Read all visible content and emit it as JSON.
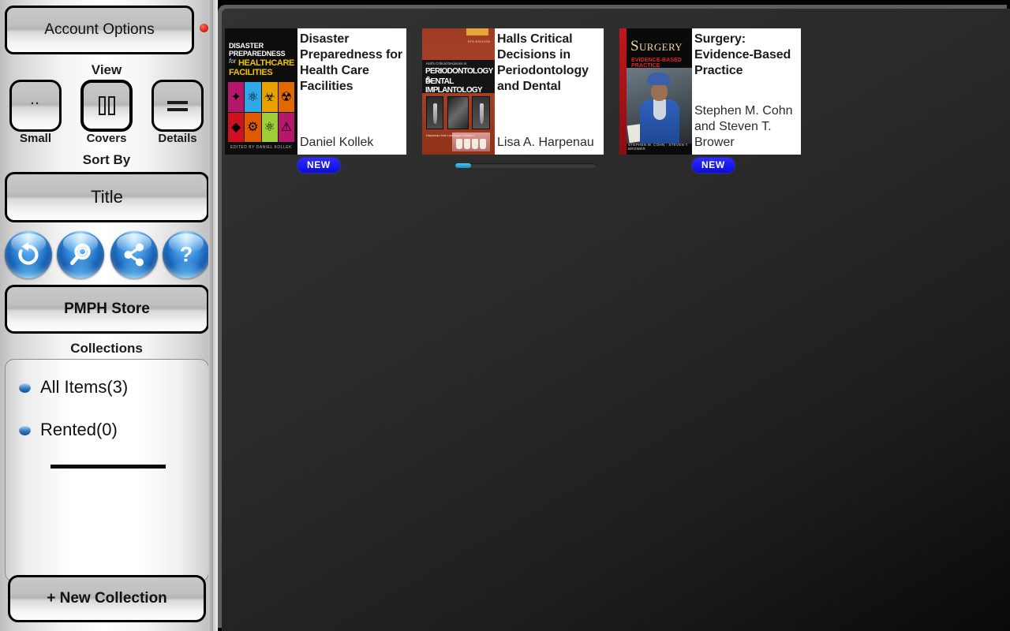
{
  "sidebar": {
    "account_options_label": "Account Options",
    "view_section_label": "View",
    "view_options": [
      {
        "caption": "Small",
        "icon": "small-grid-icon",
        "selected": false
      },
      {
        "caption": "Covers",
        "icon": "covers-icon",
        "selected": true
      },
      {
        "caption": "Details",
        "icon": "details-list-icon",
        "selected": false
      }
    ],
    "sort_by_label": "Sort By",
    "sort_by_value": "Title",
    "action_icons": [
      {
        "name": "refresh-icon",
        "label": "Refresh"
      },
      {
        "name": "search-icon",
        "label": "Search"
      },
      {
        "name": "share-icon",
        "label": "Share"
      },
      {
        "name": "help-icon",
        "label": "Help"
      }
    ],
    "store_button_label": "PMPH Store",
    "collections_label": "Collections",
    "collections": [
      {
        "label": "All Items(3)"
      },
      {
        "label": "Rented(0)"
      }
    ],
    "new_collection_label": "+ New Collection"
  },
  "books": [
    {
      "title": "Disaster Preparedness for Health Care Facilities",
      "author": "Daniel Kollek",
      "badge": "NEW",
      "progress": null,
      "cover": {
        "line1": "DISASTER",
        "line2": "PREPAREDNESS",
        "for": "for",
        "line3": "HEALTHCARE",
        "line4": "FACILITIES",
        "credit": "EDITED BY DANIEL KOLLEK",
        "tiles": [
          "☣",
          "⚗",
          "☢",
          "☣",
          "◆",
          "⚗",
          "⚛",
          "⚠"
        ],
        "tile_colors": [
          "#b5186b",
          "#2ea8e6",
          "#e8a200",
          "#e06a00",
          "#cf1020",
          "#e05a00",
          "#9ecf3a",
          "#b5186b"
        ]
      }
    },
    {
      "title": "Halls Critical Decisions in Periodontology and Dental",
      "author": "Lisa A. Harpenau",
      "badge": null,
      "progress": 11,
      "cover": {
        "eyebrow": "Hall's Critical Decisions in",
        "line1": "PERIODONTOLOGY &",
        "line2": "DENTAL IMPLANTOLOGY",
        "edition": "5TH EDITION",
        "authors": "Harpenau\nHall\nLundergan\nSandhu"
      }
    },
    {
      "title": "Surgery: Evidence-Based Practice",
      "author": "Stephen M. Cohn and Steven T. Brower",
      "badge": "NEW",
      "progress": null,
      "cover": {
        "title": "Surgery",
        "subtitle": "EVIDENCE-BASED PRACTICE",
        "credit": "STEPHEN M. COHN  ·  STEVEN T. BROWER"
      }
    }
  ],
  "colors": {
    "badge_blue": "#1414e6",
    "progress_fill": "#2fa8d8",
    "status_dot_red": "#d01b10",
    "orb_blue": "#1f6fc4",
    "content_bg_dark": "#2b2b2b"
  }
}
